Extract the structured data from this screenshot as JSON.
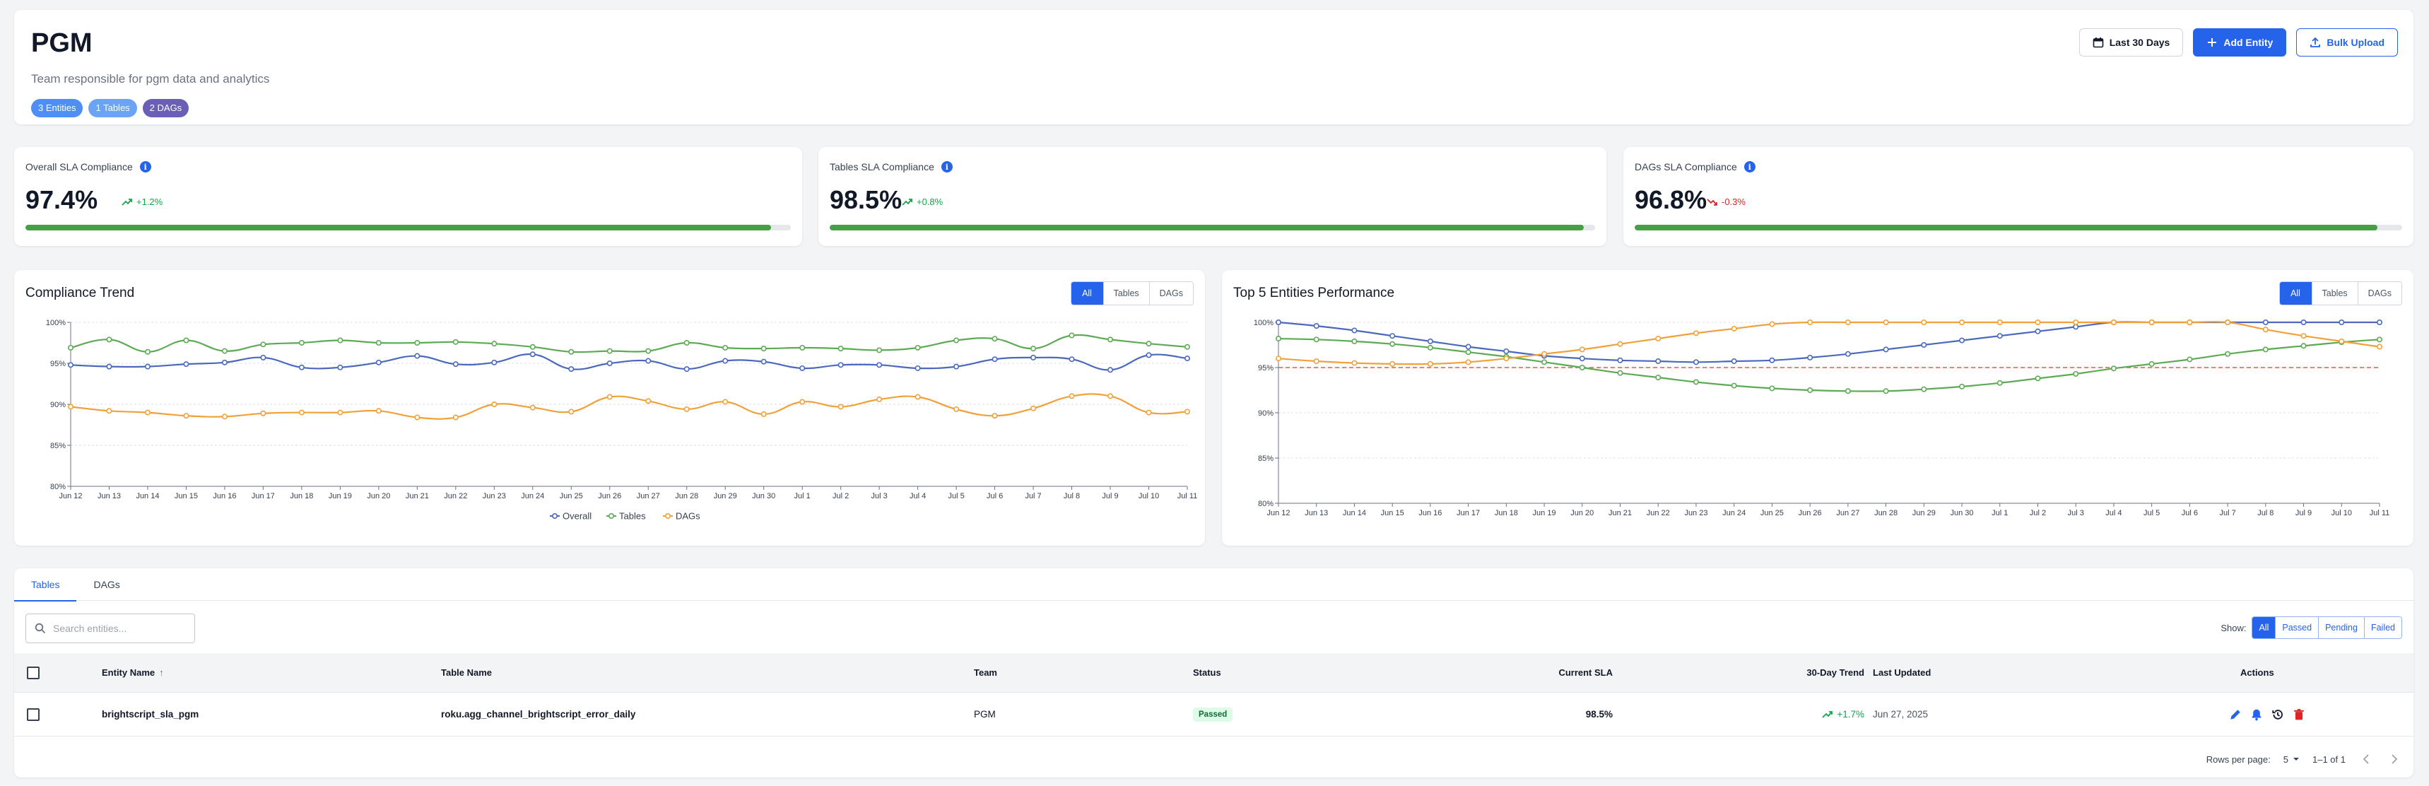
{
  "header": {
    "title": "PGM",
    "description": "Team responsible for pgm data and analytics",
    "badges": {
      "entities": "3 Entities",
      "tables": "1 Tables",
      "dags": "2 DAGs"
    },
    "actions": {
      "date_range": "Last 30 Days",
      "add_entity": "Add Entity",
      "bulk_upload": "Bulk Upload"
    }
  },
  "sla": [
    {
      "label": "Overall SLA Compliance",
      "value": "97.4%",
      "delta": "+1.2%",
      "direction": "up",
      "progress": 97.4
    },
    {
      "label": "Tables SLA Compliance",
      "value": "98.5%",
      "delta": "+0.8%",
      "direction": "up",
      "progress": 98.5
    },
    {
      "label": "DAGs SLA Compliance",
      "value": "96.8%",
      "delta": "-0.3%",
      "direction": "down",
      "progress": 96.8
    }
  ],
  "compliance_trend": {
    "title": "Compliance Trend",
    "toggles": [
      "All",
      "Tables",
      "DAGs"
    ],
    "active_toggle": "All"
  },
  "top_entities": {
    "title": "Top 5 Entities Performance",
    "toggles": [
      "All",
      "Tables",
      "DAGs"
    ],
    "active_toggle": "All"
  },
  "colors": {
    "overall": "#4a69bd",
    "tables": "#5cab54",
    "dags": "#f0a13a",
    "threshold": "#e05a4f",
    "primary": "#2563eb"
  },
  "chart_data": [
    {
      "type": "line",
      "title": "Compliance Trend",
      "x": [
        "Jun 12",
        "Jun 13",
        "Jun 14",
        "Jun 15",
        "Jun 16",
        "Jun 17",
        "Jun 18",
        "Jun 19",
        "Jun 20",
        "Jun 21",
        "Jun 22",
        "Jun 23",
        "Jun 24",
        "Jun 25",
        "Jun 26",
        "Jun 27",
        "Jun 28",
        "Jun 29",
        "Jun 30",
        "Jul 1",
        "Jul 2",
        "Jul 3",
        "Jul 4",
        "Jul 5",
        "Jul 6",
        "Jul 7",
        "Jul 8",
        "Jul 9",
        "Jul 10",
        "Jul 11"
      ],
      "ylim": [
        80,
        100
      ],
      "yticks": [
        "80%",
        "85%",
        "90%",
        "95%",
        "100%"
      ],
      "grid": true,
      "legend": "bottom",
      "series": [
        {
          "name": "Overall",
          "color": "#4a69bd",
          "values": [
            94.8,
            94.6,
            94.6,
            94.9,
            95.1,
            95.7,
            94.5,
            94.5,
            95.1,
            95.9,
            94.9,
            95.1,
            96.1,
            94.3,
            95.0,
            95.3,
            94.3,
            95.3,
            95.2,
            94.4,
            94.8,
            94.8,
            94.4,
            94.6,
            95.5,
            95.7,
            95.5,
            94.2,
            96.0,
            95.6
          ]
        },
        {
          "name": "Tables",
          "color": "#5cab54",
          "values": [
            96.9,
            97.9,
            96.4,
            97.8,
            96.5,
            97.3,
            97.5,
            97.8,
            97.5,
            97.5,
            97.6,
            97.4,
            97.0,
            96.4,
            96.5,
            96.5,
            97.5,
            96.9,
            96.8,
            96.9,
            96.8,
            96.6,
            96.9,
            97.8,
            98.0,
            96.8,
            98.4,
            97.9,
            97.4,
            97.0
          ]
        },
        {
          "name": "DAGs",
          "color": "#f0a13a",
          "values": [
            89.7,
            89.2,
            89.0,
            88.6,
            88.5,
            88.9,
            89.0,
            89.0,
            89.2,
            88.4,
            88.4,
            90.0,
            89.6,
            89.1,
            90.9,
            90.4,
            89.4,
            90.3,
            88.8,
            90.3,
            89.7,
            90.6,
            90.9,
            89.4,
            88.6,
            89.5,
            91.0,
            91.0,
            89.0,
            89.1
          ]
        }
      ]
    },
    {
      "type": "line",
      "title": "Top 5 Entities Performance",
      "x": [
        "Jun 12",
        "Jun 13",
        "Jun 14",
        "Jun 15",
        "Jun 16",
        "Jun 17",
        "Jun 18",
        "Jun 19",
        "Jun 20",
        "Jun 21",
        "Jun 22",
        "Jun 23",
        "Jun 24",
        "Jun 25",
        "Jun 26",
        "Jun 27",
        "Jun 28",
        "Jun 29",
        "Jun 30",
        "Jul 1",
        "Jul 2",
        "Jul 3",
        "Jul 4",
        "Jul 5",
        "Jul 6",
        "Jul 7",
        "Jul 8",
        "Jul 9",
        "Jul 10",
        "Jul 11"
      ],
      "ylim": [
        80,
        100
      ],
      "yticks": [
        "80%",
        "85%",
        "90%",
        "95%",
        "100%"
      ],
      "threshold": 95,
      "grid": true,
      "series": [
        {
          "color": "#4a69bd",
          "values": [
            100,
            99.6,
            99.1,
            98.5,
            97.9,
            97.3,
            96.8,
            96.3,
            96.0,
            95.8,
            95.7,
            95.6,
            95.7,
            95.8,
            96.1,
            96.5,
            97.0,
            97.5,
            98.0,
            98.5,
            99.0,
            99.5,
            100,
            100,
            100,
            100,
            100,
            100,
            100,
            100
          ]
        },
        {
          "color": "#5cab54",
          "values": [
            98.2,
            98.1,
            97.9,
            97.6,
            97.2,
            96.7,
            96.2,
            95.6,
            95.0,
            94.4,
            93.9,
            93.4,
            93.0,
            92.7,
            92.5,
            92.4,
            92.4,
            92.6,
            92.9,
            93.3,
            93.8,
            94.3,
            94.9,
            95.4,
            95.9,
            96.5,
            97.0,
            97.4,
            97.8,
            98.1
          ]
        },
        {
          "color": "#f0a13a",
          "values": [
            96.0,
            95.7,
            95.5,
            95.4,
            95.4,
            95.6,
            96.0,
            96.5,
            97.0,
            97.6,
            98.2,
            98.8,
            99.3,
            99.8,
            100,
            100,
            100,
            100,
            100,
            100,
            100,
            100,
            100,
            100,
            100,
            100,
            99.2,
            98.5,
            97.9,
            97.3
          ]
        }
      ]
    }
  ],
  "table_section": {
    "tabs": [
      "Tables",
      "DAGs"
    ],
    "active_tab": "Tables",
    "search_placeholder": "Search entities...",
    "show_label": "Show:",
    "filters": [
      "All",
      "Passed",
      "Pending",
      "Failed"
    ],
    "active_filter": "All",
    "columns": {
      "entity_name": "Entity Name",
      "table_name": "Table Name",
      "team": "Team",
      "status": "Status",
      "current_sla": "Current SLA",
      "trend": "30-Day Trend",
      "last_updated": "Last Updated",
      "actions": "Actions"
    },
    "sort_indicator": "↑",
    "rows": [
      {
        "entity_name": "brightscript_sla_pgm",
        "table_name": "roku.agg_channel_brightscript_error_daily",
        "team": "PGM",
        "status": "Passed",
        "current_sla": "98.5%",
        "trend": "+1.7%",
        "last_updated": "Jun 27, 2025"
      }
    ],
    "pagination": {
      "rows_per_page_label": "Rows per page:",
      "rows_per_page": "5",
      "range": "1–1 of 1"
    }
  }
}
